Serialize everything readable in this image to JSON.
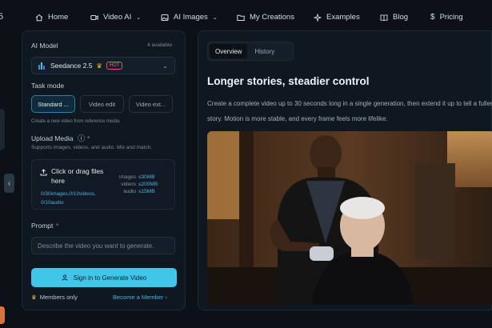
{
  "nav": {
    "brand_fragment": "5",
    "items": [
      {
        "label": "Home",
        "icon": "home-icon"
      },
      {
        "label": "Video AI",
        "icon": "video-icon"
      },
      {
        "label": "AI Images",
        "icon": "image-icon"
      },
      {
        "label": "My Creations",
        "icon": "folder-icon"
      },
      {
        "label": "Examples",
        "icon": "sparkle-icon"
      },
      {
        "label": "Blog",
        "icon": "book-icon"
      },
      {
        "label": "Pricing",
        "icon": "dollar-icon"
      }
    ]
  },
  "panel": {
    "model_label": "AI Model",
    "model_count": "4 available",
    "model_value": "Seedance 2.5",
    "model_badge": "HOT",
    "task_label": "Task mode",
    "modes": [
      "Standard ...",
      "Video edit",
      "Video ext..."
    ],
    "mode_hint": "Create a new video from reference media",
    "upload_label": "Upload Media",
    "upload_required": "*",
    "upload_hint": "Supports images, videos, and audio. Mix and match.",
    "upload_title": "Click or drag files here",
    "upload_counts": "0/30images,0/10videos, 0/10audio",
    "limits": [
      {
        "k": "images",
        "v": "≤30MB"
      },
      {
        "k": "videos",
        "v": "≤200MB"
      },
      {
        "k": "audio",
        "v": "≤15MB"
      }
    ],
    "prompt_label": "Prompt",
    "prompt_required": "*",
    "prompt_placeholder": "Describe the video you want to generate.",
    "cta_label": "Sign in to Generate Video",
    "members_label": "Members only",
    "become_label": "Become a Member ›"
  },
  "main": {
    "tabs": [
      "Overview",
      "History"
    ],
    "headline": "Longer stories, steadier control",
    "description": "Create a complete video up to 30 seconds long in a single generation, then extend it up to tell a fuller story. Motion is more stable, and every frame feels more lifelike."
  },
  "colors": {
    "accent": "#3fc6e8",
    "hot": "#e05a6a",
    "background": "#0b1117",
    "panel": "#0f1720"
  }
}
